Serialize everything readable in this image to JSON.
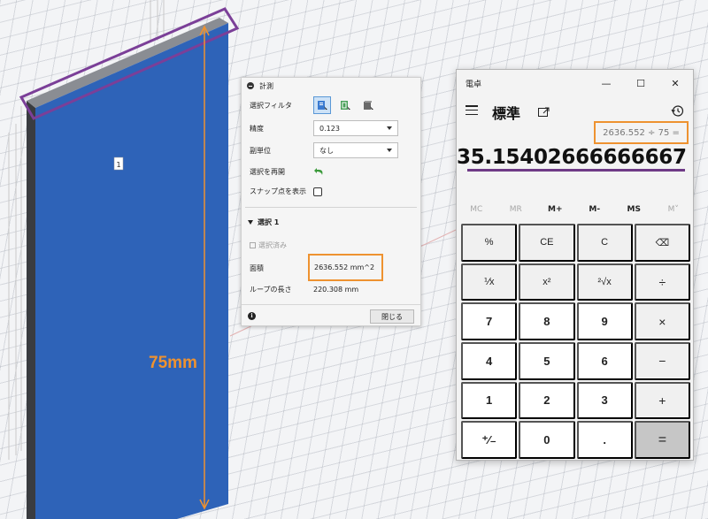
{
  "viewport": {
    "face_number": "1",
    "dimension_label": "75mm",
    "colors": {
      "face": "#2e63b8",
      "annotation": "#7b3f98",
      "dimension": "#ee9230"
    }
  },
  "measure_panel": {
    "title": "計測",
    "rows": {
      "selection_filter": "選択フィルタ",
      "precision": "精度",
      "precision_value": "0.123",
      "secondary_unit": "副単位",
      "secondary_unit_value": "なし",
      "restart_selection": "選択を再開",
      "show_snap_points": "スナップ点を表示"
    },
    "section": {
      "title": "選択 1",
      "selected": "選択済み",
      "area_label": "面積",
      "area_value": "2636.552 mm^2",
      "loop_label": "ループの長さ",
      "loop_value": "220.308 mm"
    },
    "close_label": "閉じる",
    "info_icon": "i"
  },
  "calculator": {
    "title": "電卓",
    "window_controls": {
      "minimize": "—",
      "maximize": "☐",
      "close": "✕"
    },
    "mode": "標準",
    "expression": "2636.552 ÷ 75 =",
    "result": "35.15402666666667",
    "memory": [
      "MC",
      "MR",
      "M+",
      "M-",
      "MS",
      "M˅"
    ],
    "keys": [
      "%",
      "CE",
      "C",
      "⌫",
      "⅟x",
      "x²",
      "²√x",
      "÷",
      "7",
      "8",
      "9",
      "×",
      "4",
      "5",
      "6",
      "−",
      "1",
      "2",
      "3",
      "+",
      "⁺∕₋",
      "0",
      ".",
      "="
    ],
    "colors": {
      "accent": "#ee9230",
      "underline": "#6f3a86"
    }
  }
}
